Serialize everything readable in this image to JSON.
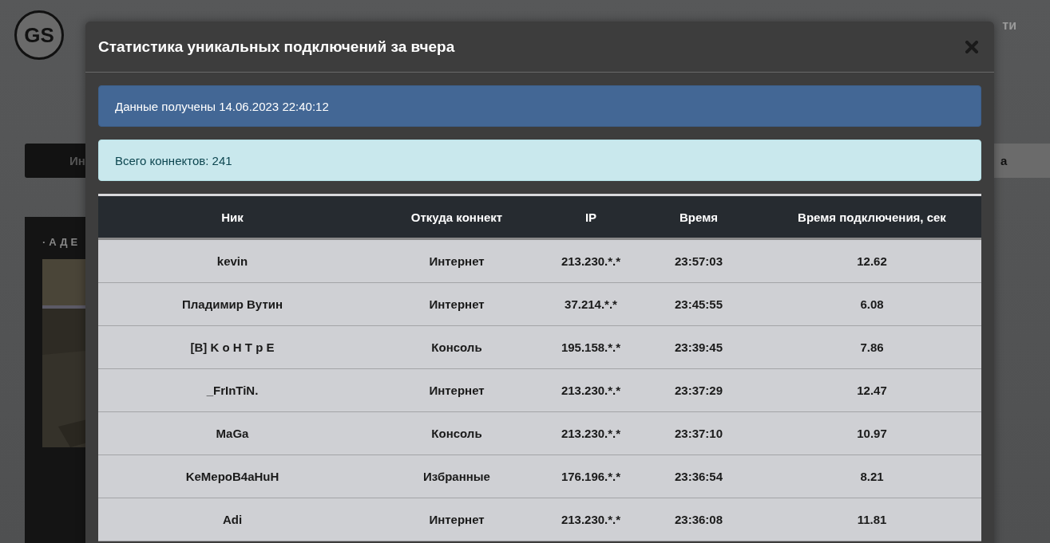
{
  "background": {
    "logo": {
      "badge": "GS"
    },
    "login": "ти",
    "nav": {
      "left": "Ин",
      "right": "а"
    },
    "card": {
      "title": "·АДЕ"
    }
  },
  "modal": {
    "title": "Статистика уникальных подключений за вчера",
    "alerts": [
      {
        "kind": "info",
        "text": "Данные получены 14.06.2023 22:40:12"
      },
      {
        "kind": "success",
        "text": "Всего коннектов: 241"
      }
    ],
    "table": {
      "columns": [
        "Ник",
        "Откуда коннект",
        "IP",
        "Время",
        "Время подключения, сек"
      ],
      "rows": [
        [
          "kevin",
          "Интернет",
          "213.230.*.*",
          "23:57:03",
          "12.62"
        ],
        [
          "Пладимир Вутин",
          "Интернет",
          "37.214.*.*",
          "23:45:55",
          "6.08"
        ],
        [
          "[B] K o H T p E",
          "Консоль",
          "195.158.*.*",
          "23:39:45",
          "7.86"
        ],
        [
          "_FrInTiN.",
          "Интернет",
          "213.230.*.*",
          "23:37:29",
          "12.47"
        ],
        [
          "MaGa",
          "Консоль",
          "213.230.*.*",
          "23:37:10",
          "10.97"
        ],
        [
          "KeMepoB4aHuH",
          "Избранные",
          "176.196.*.*",
          "23:36:54",
          "8.21"
        ],
        [
          "Adi",
          "Интернет",
          "213.230.*.*",
          "23:36:08",
          "11.81"
        ]
      ]
    }
  }
}
